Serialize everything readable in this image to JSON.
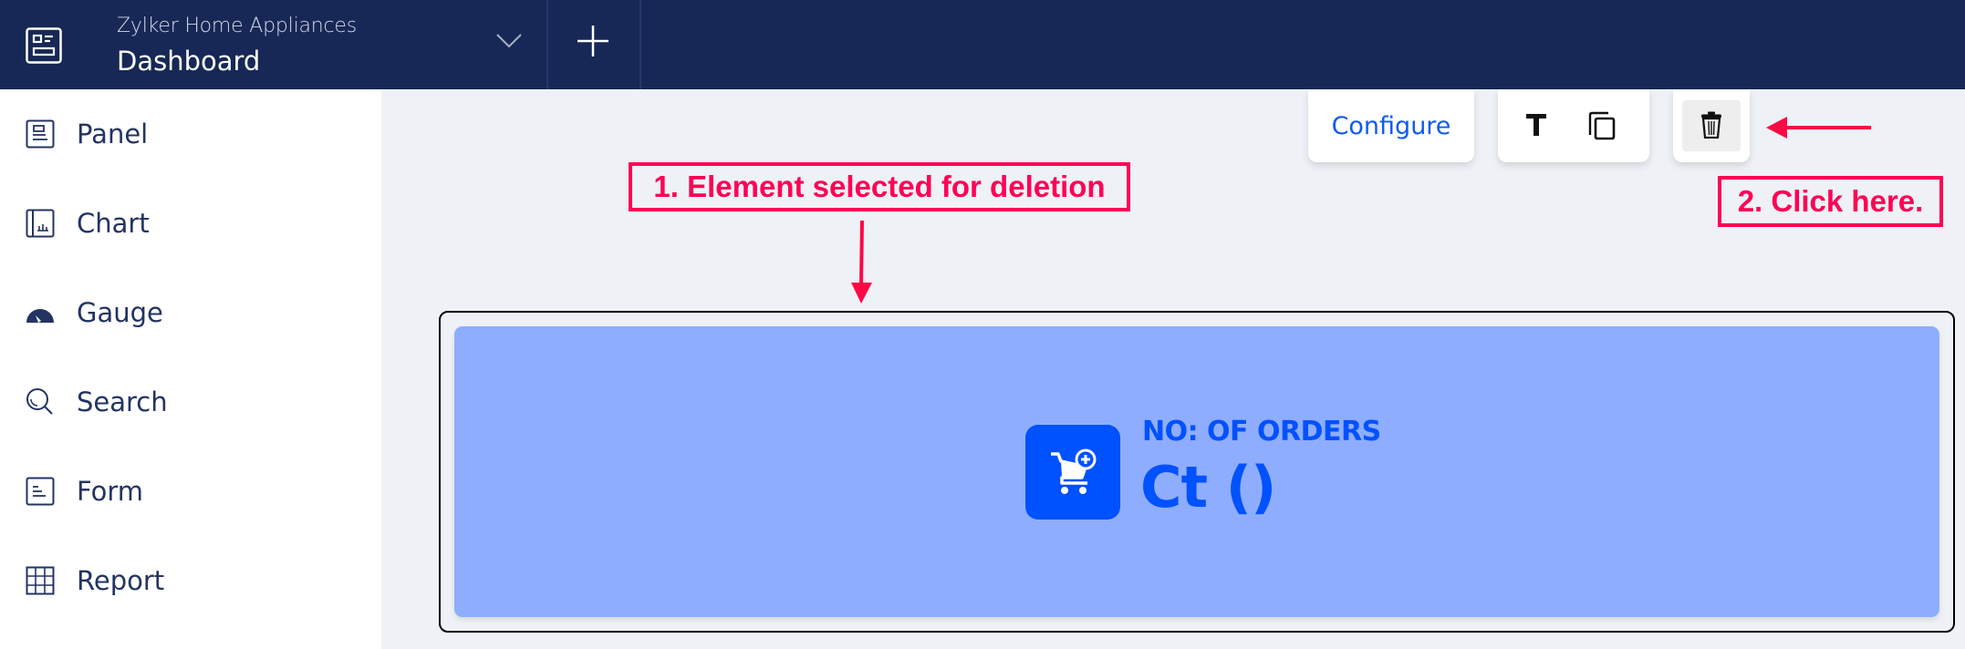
{
  "header": {
    "org_name": "Zylker Home Appliances",
    "page_title": "Dashboard",
    "logo_icon": "dashboard-icon",
    "dropdown_icon": "chevron-down-icon",
    "add_icon": "plus-icon",
    "background_color": "#172856"
  },
  "sidebar": {
    "items": [
      {
        "label": "Panel",
        "icon": "panel-icon"
      },
      {
        "label": "Chart",
        "icon": "chart-icon"
      },
      {
        "label": "Gauge",
        "icon": "gauge-icon"
      },
      {
        "label": "Search",
        "icon": "search-icon"
      },
      {
        "label": "Form",
        "icon": "form-icon"
      },
      {
        "label": "Report",
        "icon": "report-grid-icon"
      }
    ],
    "text_color": "#233463"
  },
  "toolbar": {
    "configure_label": "Configure",
    "text_tool_icon": "text-icon",
    "duplicate_icon": "copy-icon",
    "delete_icon": "trash-icon",
    "accent_color": "#0F5BF0"
  },
  "annotations": {
    "step1": "1. Element selected for deletion",
    "step2": "2. Click here.",
    "color": "#FF0055"
  },
  "widget": {
    "label": "NO: OF ORDERS",
    "value": "Ct ()",
    "icon": "cart-add-icon",
    "card_color": "#8FADFE",
    "accent_color": "#0051FF",
    "selected": true
  }
}
